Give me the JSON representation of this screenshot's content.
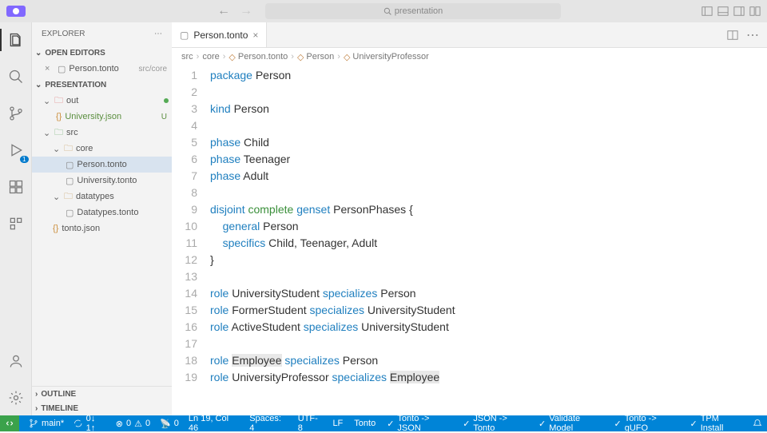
{
  "titlebar": {
    "search_placeholder": "presentation"
  },
  "sidebar": {
    "title": "EXPLORER",
    "open_editors_label": "OPEN EDITORS",
    "open_editors": [
      {
        "name": "Person.tonto",
        "dir": "src/core"
      }
    ],
    "project_label": "PRESENTATION",
    "tree": {
      "out": {
        "label": "out",
        "children": [
          {
            "name": "University.json",
            "status": "U"
          }
        ]
      },
      "src": {
        "label": "src",
        "core": {
          "label": "core",
          "children": [
            {
              "name": "Person.tonto"
            },
            {
              "name": "University.tonto"
            }
          ]
        },
        "datatypes": {
          "label": "datatypes",
          "children": [
            {
              "name": "Datatypes.tonto"
            }
          ]
        }
      },
      "root_files": [
        {
          "name": "tonto.json"
        }
      ]
    },
    "outline_label": "OUTLINE",
    "timeline_label": "TIMELINE"
  },
  "tabs": {
    "active": "Person.tonto"
  },
  "breadcrumb": [
    "src",
    "core",
    "Person.tonto",
    "Person",
    "UniversityProfessor"
  ],
  "code": {
    "lines": [
      {
        "n": 1,
        "tokens": [
          [
            "kw",
            "package"
          ],
          [
            "sp",
            " "
          ],
          [
            "ident",
            "Person"
          ]
        ]
      },
      {
        "n": 2,
        "tokens": []
      },
      {
        "n": 3,
        "tokens": [
          [
            "kw",
            "kind"
          ],
          [
            "sp",
            " "
          ],
          [
            "ident",
            "Person"
          ]
        ]
      },
      {
        "n": 4,
        "tokens": []
      },
      {
        "n": 5,
        "tokens": [
          [
            "kw",
            "phase"
          ],
          [
            "sp",
            " "
          ],
          [
            "ident",
            "Child"
          ]
        ]
      },
      {
        "n": 6,
        "tokens": [
          [
            "kw",
            "phase"
          ],
          [
            "sp",
            " "
          ],
          [
            "ident",
            "Teenager"
          ]
        ]
      },
      {
        "n": 7,
        "tokens": [
          [
            "kw",
            "phase"
          ],
          [
            "sp",
            " "
          ],
          [
            "ident",
            "Adult"
          ]
        ]
      },
      {
        "n": 8,
        "tokens": []
      },
      {
        "n": 9,
        "tokens": [
          [
            "kw",
            "disjoint"
          ],
          [
            "sp",
            " "
          ],
          [
            "kw2",
            "complete"
          ],
          [
            "sp",
            " "
          ],
          [
            "kw",
            "genset"
          ],
          [
            "sp",
            " "
          ],
          [
            "ident",
            "PersonPhases {"
          ]
        ]
      },
      {
        "n": 10,
        "tokens": [
          [
            "sp",
            "    "
          ],
          [
            "kw",
            "general"
          ],
          [
            "sp",
            " "
          ],
          [
            "ident",
            "Person"
          ]
        ]
      },
      {
        "n": 11,
        "tokens": [
          [
            "sp",
            "    "
          ],
          [
            "kw",
            "specifics"
          ],
          [
            "sp",
            " "
          ],
          [
            "ident",
            "Child, Teenager, Adult"
          ]
        ]
      },
      {
        "n": 12,
        "tokens": [
          [
            "ident",
            "}"
          ]
        ]
      },
      {
        "n": 13,
        "tokens": []
      },
      {
        "n": 14,
        "tokens": [
          [
            "kw",
            "role"
          ],
          [
            "sp",
            " "
          ],
          [
            "ident",
            "UniversityStudent "
          ],
          [
            "kw",
            "specializes"
          ],
          [
            "sp",
            " "
          ],
          [
            "ident",
            "Person"
          ]
        ]
      },
      {
        "n": 15,
        "tokens": [
          [
            "kw",
            "role"
          ],
          [
            "sp",
            " "
          ],
          [
            "ident",
            "FormerStudent "
          ],
          [
            "kw",
            "specializes"
          ],
          [
            "sp",
            " "
          ],
          [
            "ident",
            "UniversityStudent"
          ]
        ]
      },
      {
        "n": 16,
        "tokens": [
          [
            "kw",
            "role"
          ],
          [
            "sp",
            " "
          ],
          [
            "ident",
            "ActiveStudent "
          ],
          [
            "kw",
            "specializes"
          ],
          [
            "sp",
            " "
          ],
          [
            "ident",
            "UniversityStudent"
          ]
        ]
      },
      {
        "n": 17,
        "tokens": []
      },
      {
        "n": 18,
        "tokens": [
          [
            "kw",
            "role"
          ],
          [
            "sp",
            " "
          ],
          [
            "hl",
            "Employee"
          ],
          [
            "sp",
            " "
          ],
          [
            "kw",
            "specializes"
          ],
          [
            "sp",
            " "
          ],
          [
            "ident",
            "Person"
          ]
        ]
      },
      {
        "n": 19,
        "tokens": [
          [
            "kw",
            "role"
          ],
          [
            "sp",
            " "
          ],
          [
            "ident",
            "UniversityProfessor "
          ],
          [
            "kw",
            "specializes"
          ],
          [
            "sp",
            " "
          ],
          [
            "hl",
            "Employee"
          ]
        ]
      }
    ]
  },
  "statusbar": {
    "branch": "main*",
    "sync": "0↓ 1↑",
    "errors": "0",
    "warnings": "0",
    "ports": "0",
    "cursor": "Ln 19, Col 46",
    "spaces": "Spaces: 4",
    "encoding": "UTF-8",
    "eol": "LF",
    "lang": "Tonto",
    "actions": [
      "Tonto -> JSON",
      "JSON -> Tonto",
      "Validate Model",
      "Tonto -> gUFO",
      "TPM Install"
    ]
  },
  "scm_badge": "1"
}
